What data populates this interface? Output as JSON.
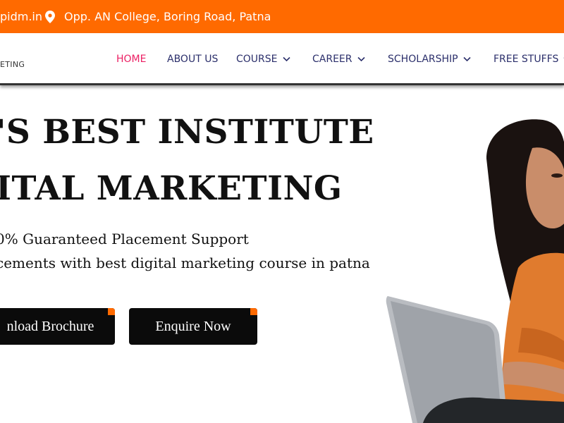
{
  "topbar": {
    "email": "pidm.in",
    "address": "Opp. AN College, Boring Road, Patna",
    "location_icon": "map-pin-icon"
  },
  "header": {
    "logo_text": "ETING",
    "nav": [
      {
        "label": "HOME",
        "active": true
      },
      {
        "label": "ABOUT US",
        "active": false
      },
      {
        "label": "COURSE",
        "active": false,
        "dropdown": true
      },
      {
        "label": "CAREER",
        "active": false,
        "dropdown": true
      },
      {
        "label": "SCHOLARSHIP",
        "active": false,
        "dropdown": true
      },
      {
        "label": "FREE STUFFS",
        "active": false,
        "dropdown": true
      }
    ]
  },
  "hero": {
    "title_line1": "'S BEST INSTITUTE",
    "title_line2": "ITAL MARKETING",
    "subtitle_line1": "0% Guaranteed Placement Support",
    "subtitle_line2": "cements with best digital marketing course in patna",
    "brochure_label": "nload Brochure",
    "enquire_label": "Enquire Now"
  },
  "colors": {
    "accent": "#ff6a00",
    "nav_text": "#2b2f6b",
    "nav_active": "#ec1f63",
    "button_bg": "#0b0b0b"
  }
}
